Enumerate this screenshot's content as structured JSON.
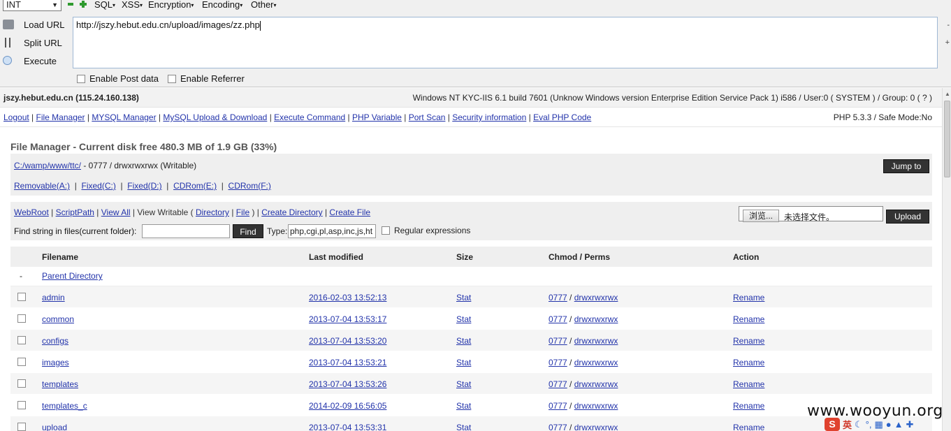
{
  "hackbar": {
    "select_value": "INT",
    "menus": [
      "SQL",
      "XSS",
      "Encryption",
      "Encoding",
      "Other"
    ],
    "load_url_label": "Load URL",
    "split_url_label": "Split URL",
    "execute_label": "Execute",
    "url_value": "http://jszy.hebut.edu.cn/upload/images/zz.php",
    "enable_post_label": "Enable Post data",
    "enable_referrer_label": "Enable Referrer",
    "right_glyph_1": "-",
    "right_glyph_2": "+"
  },
  "info": {
    "host": "jszy.hebut.edu.cn (115.24.160.138)",
    "system": "Windows NT KYC-IIS 6.1 build 7601 (Unknow Windows version Enterprise Edition Service Pack 1) i586 / User:0 ( SYSTEM ) / Group: 0 ( ? )"
  },
  "nav": {
    "links": [
      "Logout",
      "File Manager",
      "MYSQL Manager",
      "MySQL Upload & Download",
      "Execute Command",
      "PHP Variable",
      "Port Scan",
      "Security information",
      "Eval PHP Code"
    ],
    "php_version": "PHP 5.3.3 / Safe Mode:No"
  },
  "file_manager": {
    "title": "File Manager - Current disk free 480.3 MB of 1.9 GB (33%)",
    "path_link": "C:/wamp/www/ttc/",
    "path_perms": " - 0777 / drwxrwxrwx (Writable)",
    "drives": [
      "Removable(A:)",
      "Fixed(C:)",
      "Fixed(D:)",
      "CDRom(E:)",
      "CDRom(F:)"
    ],
    "jump_label": "Jump to",
    "webroot": "WebRoot",
    "scriptpath": "ScriptPath",
    "view_all": "View All",
    "view_writable": "View Writable (",
    "directory": "Directory",
    "file": "File",
    "close_paren": ")",
    "create_directory": "Create Directory",
    "create_file": "Create File",
    "find_label": "Find string in files(current folder):",
    "find_btn": "Find",
    "type_label": "Type:",
    "type_value": "php,cgi,pl,asp,inc,js,ht",
    "regex_label": "Regular expressions",
    "browse_btn": "浏览...",
    "file_status": "未选择文件。",
    "upload_btn": "Upload"
  },
  "table": {
    "headers": {
      "filename": "Filename",
      "modified": "Last modified",
      "size": "Size",
      "perms": "Chmod / Perms",
      "action": "Action"
    },
    "parent": {
      "dash": "-",
      "label": "Parent Directory"
    },
    "rows": [
      {
        "name": "admin",
        "date": "2016-02-03 13:52:13",
        "size": "Stat",
        "chmod": "0777",
        "perms": "drwxrwxrwx",
        "action": "Rename"
      },
      {
        "name": "common",
        "date": "2013-07-04 13:53:17",
        "size": "Stat",
        "chmod": "0777",
        "perms": "drwxrwxrwx",
        "action": "Rename"
      },
      {
        "name": "configs",
        "date": "2013-07-04 13:53:20",
        "size": "Stat",
        "chmod": "0777",
        "perms": "drwxrwxrwx",
        "action": "Rename"
      },
      {
        "name": "images",
        "date": "2013-07-04 13:53:21",
        "size": "Stat",
        "chmod": "0777",
        "perms": "drwxrwxrwx",
        "action": "Rename"
      },
      {
        "name": "templates",
        "date": "2013-07-04 13:53:26",
        "size": "Stat",
        "chmod": "0777",
        "perms": "drwxrwxrwx",
        "action": "Rename"
      },
      {
        "name": "templates_c",
        "date": "2014-02-09 16:56:05",
        "size": "Stat",
        "chmod": "0777",
        "perms": "drwxrwxrwx",
        "action": "Rename"
      },
      {
        "name": "upload",
        "date": "2013-07-04 13:53:31",
        "size": "Stat",
        "chmod": "0777",
        "perms": "drwxrwxrwx",
        "action": "Rename"
      }
    ]
  },
  "watermark": "www.wooyun.org",
  "tray": {
    "sogou": "S",
    "ying": "英"
  }
}
